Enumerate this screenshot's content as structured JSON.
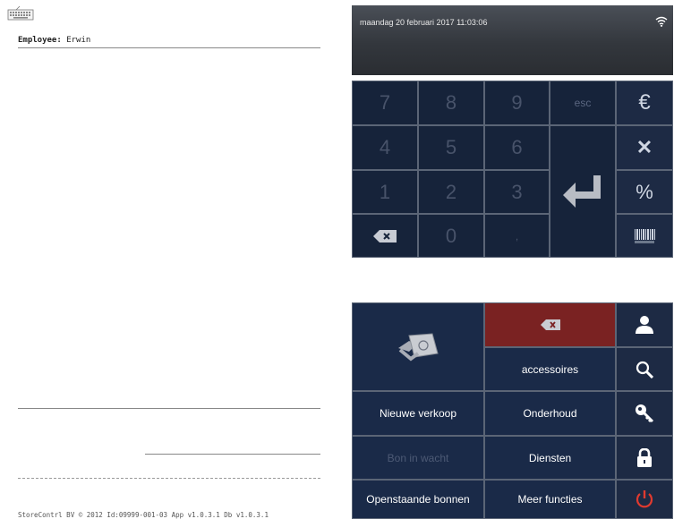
{
  "receipt": {
    "employee_label": "Employee:",
    "employee_name": "Erwin",
    "footer": "StoreContrl BV © 2012 Id:09999-001-03 App v1.0.3.1 Db v1.0.3.1"
  },
  "status": {
    "datetime": "maandag 20 februari 2017 11:03:06"
  },
  "keypad": {
    "keys": [
      "7",
      "8",
      "9",
      "4",
      "5",
      "6",
      "1",
      "2",
      "3",
      "0",
      ","
    ],
    "esc": "esc",
    "euro": "€",
    "multiply": "✕",
    "percent": "%"
  },
  "menu": {
    "accessoires": "accessoires",
    "nieuwe_verkoop": "Nieuwe verkoop",
    "onderhoud": "Onderhoud",
    "bon_in_wacht": "Bon in wacht",
    "diensten": "Diensten",
    "openstaande_bonnen": "Openstaande bonnen",
    "meer_functies": "Meer functies"
  },
  "colors": {
    "key_bg": "#16233a",
    "menu_bg": "#1a2a48",
    "delete_red": "#7a2222",
    "power_red": "#e03a2f"
  },
  "icons": [
    "keyboard-icon",
    "wifi-icon",
    "euro-icon",
    "multiply-icon",
    "percent-icon",
    "barcode-icon",
    "backspace-icon",
    "enter-icon",
    "payment-icon",
    "delete-icon",
    "user-icon",
    "search-icon",
    "key-icon",
    "lock-icon",
    "power-icon"
  ]
}
